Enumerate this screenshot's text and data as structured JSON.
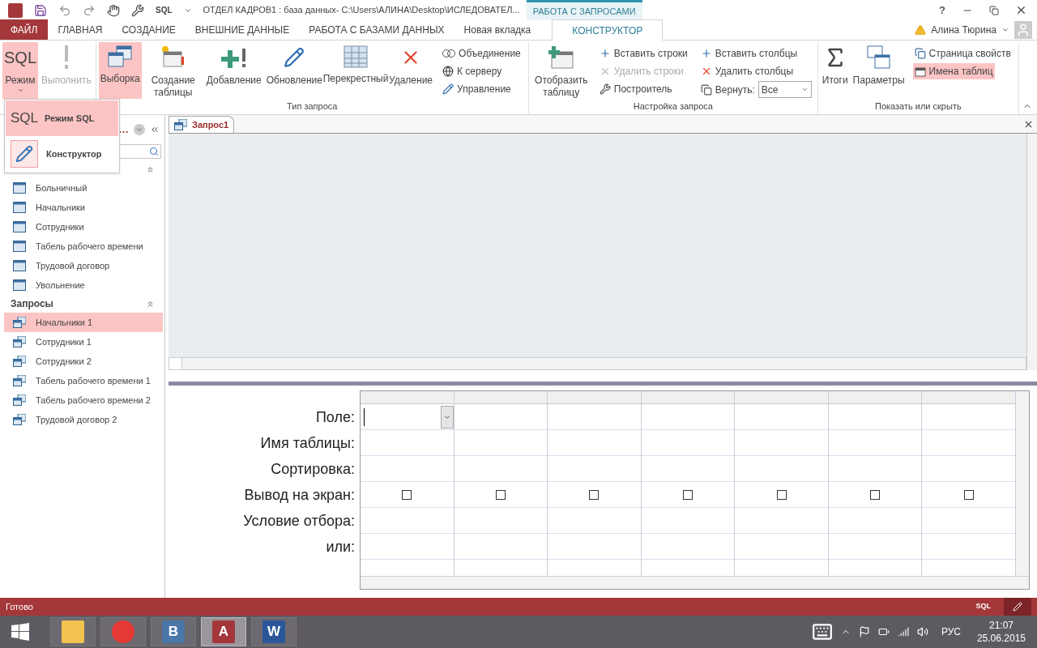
{
  "title_bar": {
    "qat_label": "SQL",
    "title": "ОТДЕЛ КАДРОВ1 : база данных- C:\\Users\\АЛИНА\\Desktop\\ИСЛЕДОВАТЕЛ...",
    "context_label": "РАБОТА С ЗАПРОСАМИ",
    "help": "?"
  },
  "ribbon_tabs": [
    {
      "label": "ФАЙЛ",
      "kind": "file",
      "selected": false
    },
    {
      "label": "ГЛАВНАЯ",
      "kind": "tab",
      "selected": false
    },
    {
      "label": "СОЗДАНИЕ",
      "kind": "tab",
      "selected": false
    },
    {
      "label": "ВНЕШНИЕ ДАННЫЕ",
      "kind": "tab",
      "selected": false
    },
    {
      "label": "РАБОТА С БАЗАМИ ДАННЫХ",
      "kind": "tab",
      "selected": false
    },
    {
      "label": "Новая вкладка",
      "kind": "tab",
      "selected": false
    },
    {
      "label": "КОНСТРУКТОР",
      "kind": "tab",
      "selected": true
    }
  ],
  "user": {
    "name": "Алина Тюрина"
  },
  "ribbon_groups": [
    {
      "items": [
        {
          "kind": "large",
          "icon_text": "SQL",
          "label": "Режим",
          "dropdown": true,
          "selected": true,
          "disabled": false
        },
        {
          "kind": "large",
          "label": "Выполнить",
          "selected": false,
          "disabled": true
        }
      ]
    },
    {
      "label": "Тип запроса",
      "items": [
        {
          "kind": "large",
          "label": "Выборка",
          "dropdown": false,
          "selected": true,
          "disabled": false
        },
        {
          "kind": "large",
          "label": "Создание таблицы",
          "dropdown": false,
          "selected": false,
          "disabled": false
        },
        {
          "kind": "large",
          "label": "Добавление",
          "dropdown": false,
          "selected": false,
          "disabled": false
        },
        {
          "kind": "large",
          "label": "Обновление",
          "dropdown": false,
          "selected": false,
          "disabled": false
        },
        {
          "kind": "large",
          "label": "Перекрестный",
          "dropdown": false,
          "selected": false,
          "disabled": false
        },
        {
          "kind": "large",
          "label": "Удаление",
          "dropdown": false,
          "selected": false,
          "disabled": false
        },
        {
          "kind": "stack",
          "items": [
            {
              "label": "Объединение",
              "selected": false,
              "disabled": false
            },
            {
              "label": "К серверу",
              "selected": false,
              "disabled": false
            },
            {
              "label": "Управление",
              "selected": false,
              "disabled": false
            }
          ]
        }
      ]
    },
    {
      "label": "Настройка запроса",
      "items": [
        {
          "kind": "large",
          "label": "Отобразить таблицу",
          "dropdown": false,
          "selected": false,
          "disabled": false
        },
        {
          "kind": "stack",
          "items": [
            {
              "label": "Вставить строки",
              "selected": false,
              "disabled": false
            },
            {
              "label": "Удалить строки",
              "selected": false,
              "disabled": true
            },
            {
              "label": "Построитель",
              "selected": false,
              "disabled": false
            }
          ]
        },
        {
          "kind": "stack",
          "items": [
            {
              "label": "Вставить столбцы",
              "selected": false,
              "disabled": false
            },
            {
              "label": "Удалить столбцы",
              "selected": false,
              "disabled": false
            },
            {
              "label": "Вернуть:",
              "selected": false,
              "disabled": false,
              "combo_value": "Все"
            }
          ]
        }
      ]
    },
    {
      "label": "Показать или скрыть",
      "items": [
        {
          "kind": "large",
          "label": "Итоги",
          "dropdown": false,
          "selected": false,
          "disabled": false
        },
        {
          "kind": "large",
          "label": "Параметры",
          "dropdown": false,
          "selected": false,
          "disabled": false
        },
        {
          "kind": "stack",
          "items": [
            {
              "label": "Страница свойств",
              "selected": false,
              "disabled": false
            },
            {
              "label": "Имена таблиц",
              "selected": true,
              "disabled": false
            }
          ]
        }
      ]
    }
  ],
  "mode_menu": [
    {
      "icon_text": "SQL",
      "label": "Режим SQL",
      "selected": true
    },
    {
      "label": "Конструктор",
      "selected": false
    }
  ],
  "nav_pane": {
    "title": "…",
    "groups": [
      {
        "items": [
          {
            "label": "Больничный",
            "kind": "table",
            "selected": false
          },
          {
            "label": "Начальники",
            "kind": "table",
            "selected": false
          },
          {
            "label": "Сотрудники",
            "kind": "table",
            "selected": false
          },
          {
            "label": "Табель рабочего времени",
            "kind": "table",
            "selected": false
          },
          {
            "label": "Трудовой договор",
            "kind": "table",
            "selected": false
          },
          {
            "label": "Увольнение",
            "kind": "table",
            "selected": false
          }
        ]
      },
      {
        "label": "Запросы",
        "items": [
          {
            "label": "Начальники 1",
            "kind": "query",
            "selected": true
          },
          {
            "label": "Сотрудники 1",
            "kind": "query",
            "selected": false
          },
          {
            "label": "Сотрудники 2",
            "kind": "query",
            "selected": false
          },
          {
            "label": "Табель рабочего времени 1",
            "kind": "query",
            "selected": false
          },
          {
            "label": "Табель рабочего времени 2",
            "kind": "query",
            "selected": false
          },
          {
            "label": "Трудовой договор 2",
            "kind": "query",
            "selected": false
          }
        ]
      }
    ]
  },
  "document_tab": {
    "label": "Запрос1"
  },
  "design_grid": {
    "row_labels": [
      "Поле:",
      "Имя таблицы:",
      "Сортировка:",
      "Вывод на экран:",
      "Условие отбора:",
      "или:"
    ],
    "columns": [
      {
        "show": false
      },
      {
        "show": false
      },
      {
        "show": false
      },
      {
        "show": false
      },
      {
        "show": false
      },
      {
        "show": false
      },
      {
        "show": false
      }
    ]
  },
  "status_bar": {
    "text": "Готово",
    "view_label": "SQL"
  },
  "taskbar": {
    "apps": [
      {
        "kind": "explorer",
        "selected": false
      },
      {
        "kind": "browser",
        "selected": false
      },
      {
        "kind": "vk",
        "label": "В",
        "selected": false
      },
      {
        "kind": "access",
        "label": "A",
        "selected": true
      },
      {
        "kind": "word",
        "label": "W",
        "selected": false
      }
    ],
    "language": "РУС",
    "time": "21:07",
    "date": "25.06.2015"
  }
}
